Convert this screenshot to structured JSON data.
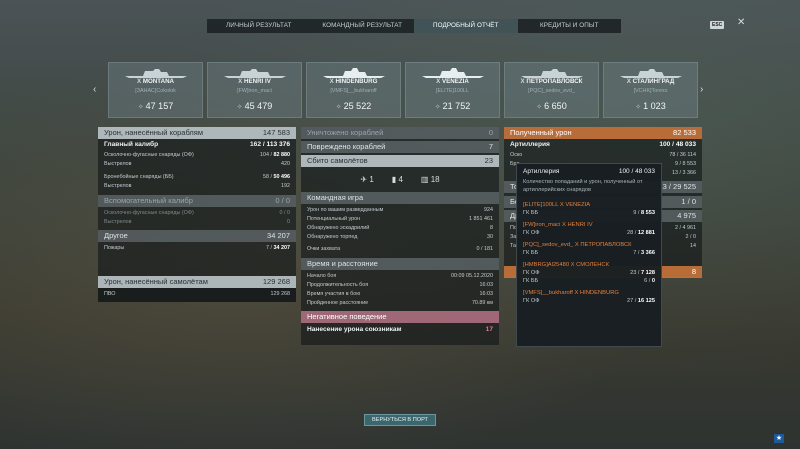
{
  "tabs": [
    "ЛИЧНЫЙ РЕЗУЛЬТАТ",
    "КОМАНДНЫЙ РЕЗУЛЬТАТ",
    "ПОДРОБНЫЙ ОТЧЁТ",
    "КРЕДИТЫ И ОПЫТ"
  ],
  "esc_label": "ESC",
  "ships": [
    {
      "tier": "X",
      "name": "MONTANA",
      "player": "[ЗАНАС]Cokolok",
      "score": "47 157"
    },
    {
      "tier": "X",
      "name": "HENRI IV",
      "player": "[FW]iron_maci",
      "score": "45 479"
    },
    {
      "tier": "X",
      "name": "HINDENBURG",
      "player": "[VMFS]__bukharoff",
      "score": "25 522"
    },
    {
      "tier": "X",
      "name": "VENEZIA",
      "player": "[ELITE]100LL",
      "score": "21 752"
    },
    {
      "tier": "X",
      "name": "ПЕТРОПАВЛОВСК",
      "player": "[PQC]_sedov_evd_",
      "score": "6 650"
    },
    {
      "tier": "X",
      "name": "СТАЛИНГРАД",
      "player": "[VCHK]Torexx",
      "score": "1 023"
    }
  ],
  "left": {
    "damage_header": {
      "label": "Урон, нанесённый кораблям",
      "value": "147 583"
    },
    "main_caliber": {
      "label": "Главный калибр",
      "a": "162",
      "b": "113 376"
    },
    "he_shells": {
      "label": "Осколочно-фугасные снаряды (ОФ)",
      "a": "104",
      "b": "82 880"
    },
    "he_shots": {
      "label": "Выстрелов",
      "value": "420"
    },
    "ap_shells": {
      "label": "Бронебойные снаряды (ББ)",
      "a": "58",
      "b": "50 496"
    },
    "ap_shots": {
      "label": "Выстрелов",
      "value": "192"
    },
    "secondary_header": {
      "label": "Вспомогательный калибр",
      "value": "0 / 0"
    },
    "sec_he": {
      "label": "Осколочно-фугасные снаряды (ОФ)",
      "value": "0 / 0"
    },
    "sec_shots": {
      "label": "Выстрелов",
      "value": "0"
    },
    "other_header": {
      "label": "Другое",
      "value": "34 207"
    },
    "fires": {
      "label": "Пожары",
      "a": "7",
      "b": "34 207"
    },
    "planes_header": {
      "label": "Урон, нанесённый самолётам",
      "value": "129 268"
    },
    "aa": {
      "label": "ПВО",
      "value": "129 268"
    }
  },
  "middle": {
    "destroyed": {
      "label": "Уничтожено кораблей",
      "value": "0"
    },
    "damaged": {
      "label": "Повреждено кораблей",
      "value": "7"
    },
    "planes_down": {
      "label": "Сбито самолётов",
      "value": "23"
    },
    "icons": [
      "1",
      "4",
      "18"
    ],
    "team_header": "Командная игра",
    "team_rows": [
      {
        "label": "Урон по вашим разведданным",
        "value": "924"
      },
      {
        "label": "Потенциальный урон",
        "value": "1 851 461"
      },
      {
        "label": "Обнаружено эскадрилий",
        "value": "8"
      },
      {
        "label": "Обнаружено торпед",
        "value": "30"
      },
      {
        "label": "Очки захвата",
        "value": "0 / 181"
      }
    ],
    "time_header": "Время и расстояние",
    "time_rows": [
      {
        "label": "Начало боя",
        "value": "00:09 05.12.2020"
      },
      {
        "label": "Продолжительность боя",
        "value": "16:03"
      },
      {
        "label": "Время участия в бою",
        "value": "16:03"
      },
      {
        "label": "Пройденное расстояние",
        "value": "70.89 км"
      }
    ],
    "neg_header": "Негативное поведение",
    "ally_damage": {
      "label": "Нанесение урона союзникам",
      "value": "17"
    }
  },
  "right": {
    "received_header": {
      "label": "Полученный урон",
      "value": "82 533"
    },
    "artillery": {
      "label": "Артиллерия",
      "a": "100",
      "b": "48 033"
    },
    "partial_values": [
      "78 / 36 114",
      "9 / 8 553",
      "13 / 3 366",
      "3 / 29 525",
      "1 / 0",
      "4 975",
      "2 / 4 961",
      "2 / 0",
      "14",
      "8"
    ],
    "partial_labels": [
      "Оско",
      "Бро",
      "То",
      "Бо",
      "Др",
      "По",
      "Зат",
      "Тар"
    ]
  },
  "tooltip": {
    "title": "Артиллерия",
    "a": "100",
    "b": "48 033",
    "desc": "Количество попаданий и урон, полученный от артиллерийских снарядов",
    "entries": [
      {
        "ship": "[ELITE]100LL  X VENEZIA",
        "rows": [
          {
            "label": "ГК ББ",
            "a": "9",
            "b": "8 553"
          }
        ]
      },
      {
        "ship": "[FW]iron_maci  X HENRI IV",
        "rows": [
          {
            "label": "ГК ОФ",
            "a": "28",
            "b": "12 881"
          }
        ]
      },
      {
        "ship": "[PQC]_sedov_evd_  X ПЕТРОПАВЛОВСК",
        "rows": [
          {
            "label": "ГК ББ",
            "a": "7",
            "b": "3 366"
          }
        ]
      },
      {
        "ship": "[HMBRG]Al25480  X СМОЛЕНСК",
        "rows": [
          {
            "label": "ГК ОФ",
            "a": "23",
            "b": "7 128"
          },
          {
            "label": "ГК ББ",
            "a": "6",
            "b": "0"
          }
        ]
      },
      {
        "ship": "[VMFS]__bukharoff  X HINDENBURG",
        "rows": [
          {
            "label": "ГК ОФ",
            "a": "27",
            "b": "16 125"
          }
        ]
      }
    ]
  },
  "return_button": "ВЕРНУТЬСЯ В ПОРТ"
}
